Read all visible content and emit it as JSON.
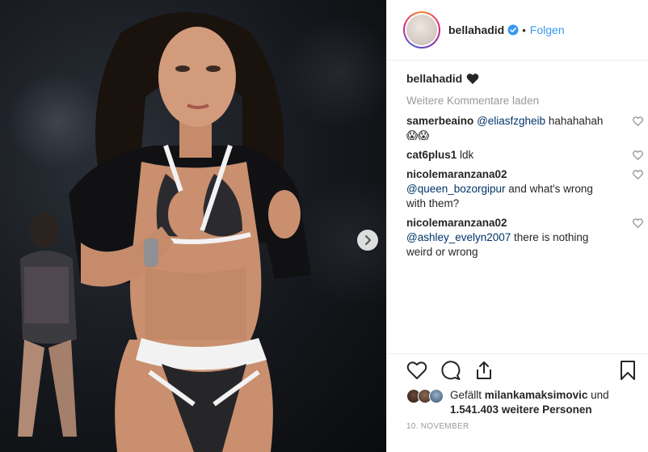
{
  "post": {
    "media": {
      "image_alt": "runway photo",
      "next_icon": "chevron-right-icon"
    },
    "header": {
      "username": "bellahadid",
      "verified_icon": "verified-badge-icon",
      "separator": "•",
      "follow_label": "Folgen"
    },
    "caption": {
      "username": "bellahadid",
      "emoji_icon": "black-heart-icon"
    },
    "load_more_label": "Weitere Kommentare laden",
    "comments": [
      {
        "username": "samerbeaino",
        "mention": "@eliasfzgheib",
        "text": " hahahahah😱😱"
      },
      {
        "username": "cat6plus1",
        "mention": "",
        "text": "ldk"
      },
      {
        "username": "nicolemaranzana02",
        "mention": "@queen_bozorgipur",
        "text": " and what's wrong with them?"
      },
      {
        "username": "nicolemaranzana02",
        "mention": "@ashley_evelyn2007",
        "text": " there is nothing weird or wrong"
      }
    ],
    "actions": {
      "like_icon": "heart-outline-icon",
      "comment_icon": "comment-icon",
      "share_icon": "share-icon",
      "save_icon": "bookmark-icon"
    },
    "likes": {
      "prefix": "Gefällt ",
      "user": "milankamaksimovic",
      "middle": " und ",
      "count": "1.541.403",
      "suffix": " weitere Personen"
    },
    "date": "10. NOVEMBER",
    "colors": {
      "accent": "#3897f0",
      "mention": "#003569",
      "muted": "#999999",
      "text": "#262626"
    }
  }
}
